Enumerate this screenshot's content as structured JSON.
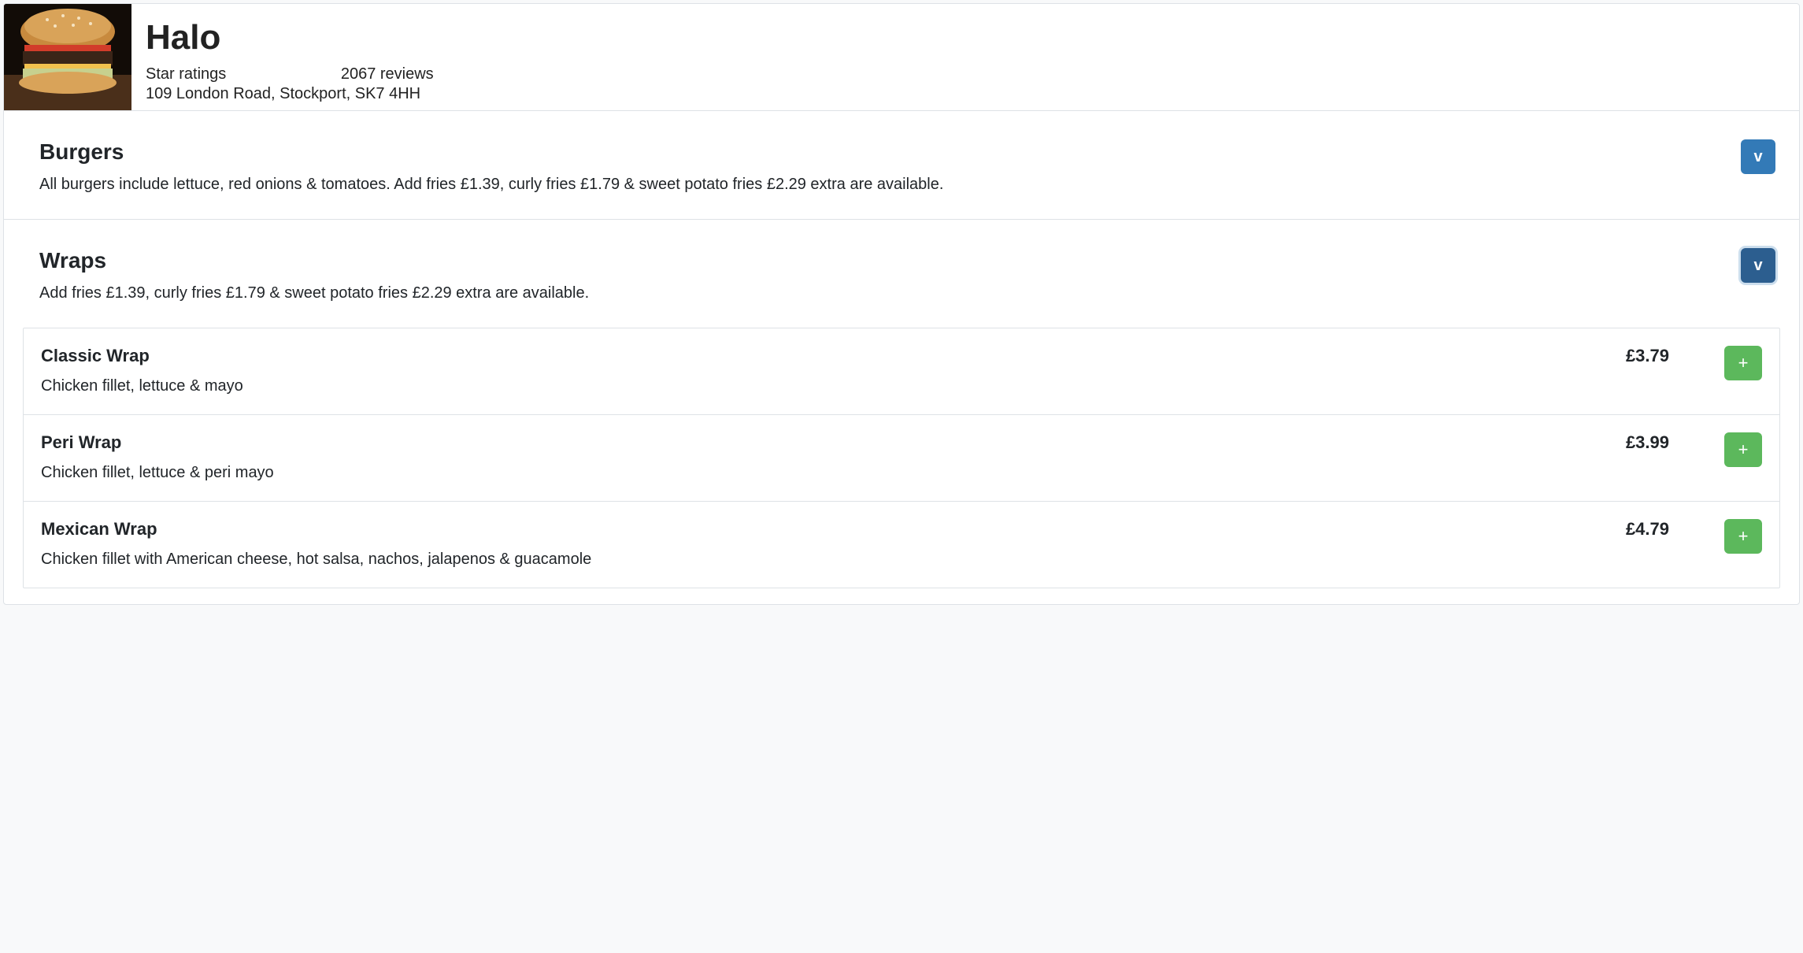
{
  "restaurant": {
    "name": "Halo",
    "star_label": "Star ratings",
    "reviews": "2067 reviews",
    "address": "109 London Road, Stockport, SK7 4HH"
  },
  "collapse_label": "v",
  "plus_label": "+",
  "sections": [
    {
      "title": "Burgers",
      "desc": "All burgers include lettuce, red onions & tomatoes. Add fries £1.39, curly fries £1.79 & sweet potato fries £2.29 extra are available.",
      "expanded": false,
      "items": []
    },
    {
      "title": "Wraps",
      "desc": "Add fries £1.39, curly fries £1.79 & sweet potato fries £2.29 extra are available.",
      "expanded": true,
      "items": [
        {
          "name": "Classic Wrap",
          "desc": "Chicken fillet, lettuce & mayo",
          "price": "£3.79"
        },
        {
          "name": "Peri Wrap",
          "desc": "Chicken fillet, lettuce & peri mayo",
          "price": "£3.99"
        },
        {
          "name": "Mexican Wrap",
          "desc": "Chicken fillet with American cheese, hot salsa, nachos, jalapenos & guacamole",
          "price": "£4.79"
        }
      ]
    }
  ]
}
